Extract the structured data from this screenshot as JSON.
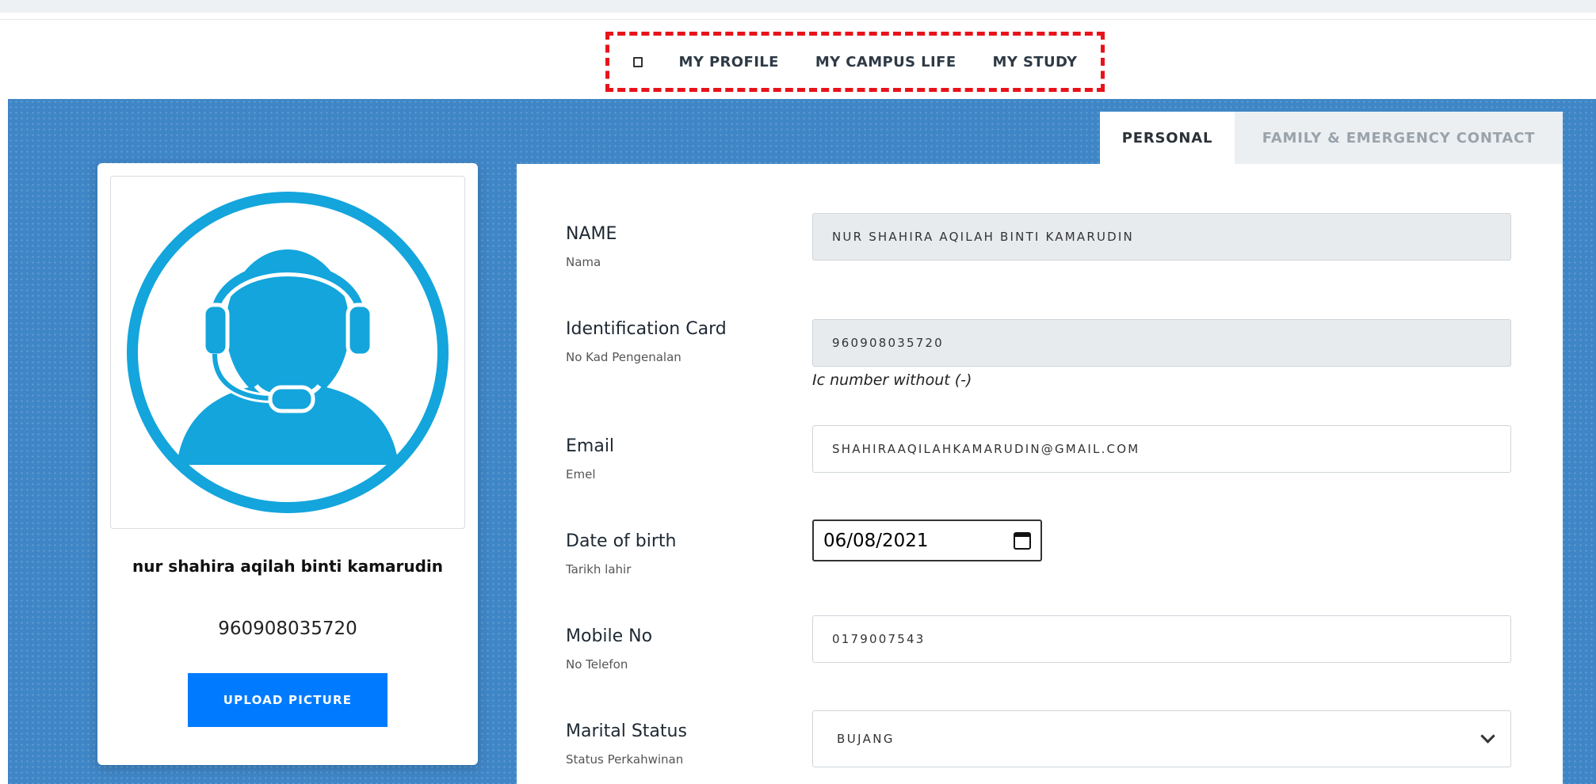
{
  "nav": {
    "home_icon": "home-icon",
    "items": [
      {
        "label": "MY PROFILE"
      },
      {
        "label": "MY CAMPUS LIFE"
      },
      {
        "label": "MY STUDY"
      }
    ]
  },
  "tabs": [
    {
      "label": "PERSONAL",
      "active": true
    },
    {
      "label": "FAMILY & EMERGENCY CONTACT",
      "active": false
    }
  ],
  "profile": {
    "name": "nur shahira aqilah binti kamarudin",
    "ic": "960908035720",
    "upload_label": "UPLOAD PICTURE",
    "avatar_icon": "support-agent-icon",
    "avatar_color": "#13a5dc"
  },
  "form": {
    "name": {
      "label": "NAME",
      "sublabel": "Nama",
      "value": "NUR SHAHIRA AQILAH BINTI KAMARUDIN"
    },
    "ic": {
      "label": "Identification Card",
      "sublabel": "No Kad Pengenalan",
      "value": "960908035720",
      "hint": "Ic number without (-)"
    },
    "email": {
      "label": "Email",
      "sublabel": "Emel",
      "value": "SHAHIRAAQILAHKAMARUDIN@GMAIL.COM"
    },
    "dob": {
      "label": "Date of birth",
      "sublabel": "Tarikh lahir",
      "value": "06/08/2021"
    },
    "mobile": {
      "label": "Mobile No",
      "sublabel": "No Telefon",
      "value": "0179007543"
    },
    "marital": {
      "label": "Marital Status",
      "sublabel": "Status Perkahwinan",
      "value": "BUJANG"
    }
  },
  "colors": {
    "accent": "#007bff",
    "hero": "#3f86c7",
    "highlight": "#e8121a"
  }
}
